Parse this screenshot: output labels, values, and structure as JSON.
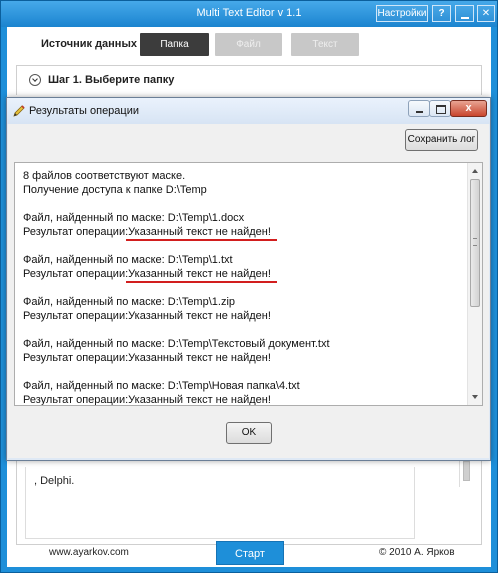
{
  "main_window": {
    "title": "Multi Text Editor v 1.1",
    "settings_label": "Настройки",
    "help_label": "?",
    "close_label": "✕"
  },
  "source": {
    "label": "Источник данных",
    "tabs": [
      {
        "label": "Папка",
        "active": true
      },
      {
        "label": "Файл",
        "active": false
      },
      {
        "label": "Текст",
        "active": false
      }
    ]
  },
  "step": {
    "title": "Шаг 1. Выберите папку"
  },
  "lower": {
    "text": ", Delphi."
  },
  "footer": {
    "site": "www.ayarkov.com",
    "start_label": "Старт",
    "copyright": "© 2010 А. Ярков"
  },
  "dialog": {
    "title": "Результаты операции",
    "save_log_label": "Сохранить лог",
    "ok_label": "OK",
    "close_label": "x",
    "log_lines": [
      {
        "text": "8 файлов соответствуют маске."
      },
      {
        "text": "Получение доступа к папке D:\\Temp"
      },
      {
        "text": ""
      },
      {
        "text": "Файл, найденный по маске: D:\\Temp\\1.docx"
      },
      {
        "prefix": "Результат операции:",
        "result": "Указанный текст не найден!",
        "underline": true
      },
      {
        "text": ""
      },
      {
        "text": "Файл, найденный по маске: D:\\Temp\\1.txt"
      },
      {
        "prefix": "Результат операции:",
        "result": "Указанный текст не найден!",
        "underline": true
      },
      {
        "text": ""
      },
      {
        "text": "Файл, найденный по маске: D:\\Temp\\1.zip"
      },
      {
        "prefix": "Результат операции:",
        "result": "Указанный текст не найден!",
        "underline": false
      },
      {
        "text": ""
      },
      {
        "text": "Файл, найденный по маске: D:\\Temp\\Текстовый документ.txt"
      },
      {
        "prefix": "Результат операции:",
        "result": "Указанный текст не найден!",
        "underline": false
      },
      {
        "text": ""
      },
      {
        "text": "Файл, найденный по маске: D:\\Temp\\Новая папка\\4.txt"
      },
      {
        "prefix": "Результат операции:",
        "result": "Указанный текст не найден!",
        "underline": false
      }
    ]
  },
  "colors": {
    "accent": "#1e8fd9",
    "active_tab": "#3c3c3c",
    "inactive_tab": "#c8c8c8",
    "highlight_underline": "#d21e1e"
  }
}
